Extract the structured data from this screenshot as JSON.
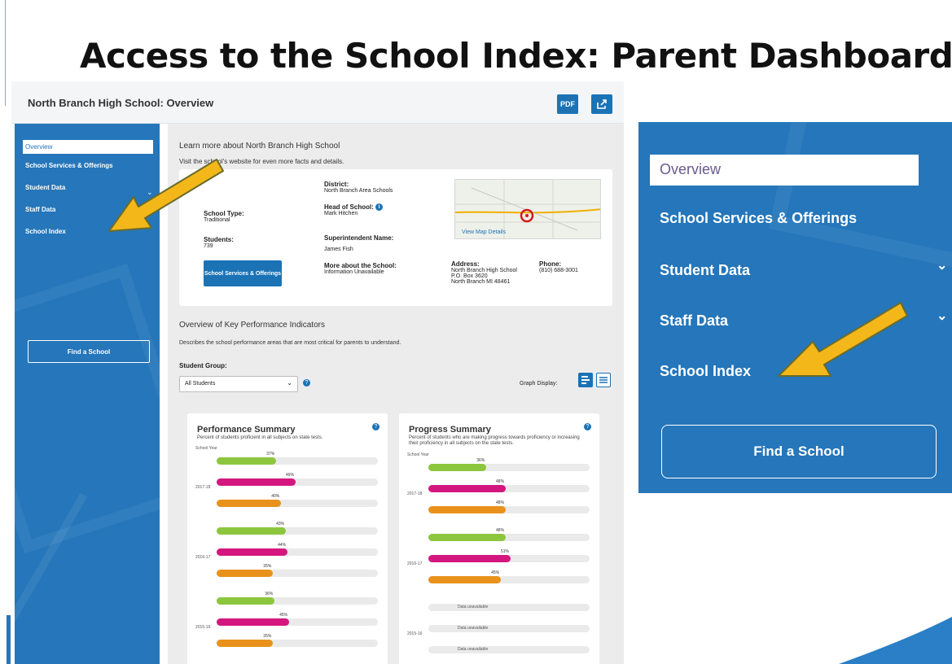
{
  "slide": {
    "title": "Access to the School Index: Parent Dashboard"
  },
  "dashboard": {
    "header_title": "North Branch High School: Overview",
    "pdf_label": "PDF",
    "share_icon": "share-icon",
    "sidebar": {
      "items": [
        {
          "label": "Overview",
          "active": true
        },
        {
          "label": "School Services & Offerings"
        },
        {
          "label": "Student Data"
        },
        {
          "label": "Staff Data"
        },
        {
          "label": "School Index"
        }
      ],
      "find_school": "Find a School"
    },
    "intro": {
      "learn_more": "Learn more about North Branch High School",
      "visit": "Visit the school's website for even more facts and details."
    },
    "info": {
      "district_label": "District:",
      "district_value": "North Branch Area Schools",
      "school_type_label": "School Type:",
      "school_type_value": "Traditional",
      "head_label": "Head of School:",
      "head_value": "Mark Hitchen",
      "students_label": "Students:",
      "students_value": "739",
      "superintendent_label": "Superintendent Name:",
      "superintendent_value": "James Fish",
      "more_label": "More about the School:",
      "more_value": "Information Unavailable",
      "address_label": "Address:",
      "address_line1": "North Branch High School",
      "address_line2": "P.O. Box 3620",
      "address_line3": "North Branch MI 48461",
      "phone_label": "Phone:",
      "phone_value": "(810) 688-3001",
      "services_button": "School Services & Offerings",
      "map_link": "View Map Details"
    },
    "kpi": {
      "title": "Overview of Key Performance Indicators",
      "description": "Describes the school performance areas that are most critical for parents to understand.",
      "student_group_label": "Student Group:",
      "student_group_value": "All Students",
      "display_label": "Graph Display:"
    },
    "colors": {
      "sidebar": "#2576ba",
      "green": "#8cc63e",
      "magenta": "#d4177f",
      "orange": "#e8921c"
    },
    "performance": {
      "title": "Performance Summary",
      "subtitle": "Percent of students proficient in all subjects on state tests.",
      "year_label": "School Year",
      "axis_ticks": [
        "0%",
        "20%",
        "40%",
        "60%",
        "80%",
        "100%"
      ],
      "groups": [
        {
          "year": "2017-18",
          "bars": [
            {
              "color": "green",
              "value": 37,
              "label": "37%"
            },
            {
              "color": "magenta",
              "value": 49,
              "label": "49%"
            },
            {
              "color": "orange",
              "value": 40,
              "label": "40%"
            }
          ]
        },
        {
          "year": "2016-17",
          "bars": [
            {
              "color": "green",
              "value": 43,
              "label": "43%"
            },
            {
              "color": "magenta",
              "value": 44,
              "label": "44%"
            },
            {
              "color": "orange",
              "value": 35,
              "label": "35%"
            }
          ]
        },
        {
          "year": "2015-16",
          "bars": [
            {
              "color": "green",
              "value": 36,
              "label": "36%"
            },
            {
              "color": "magenta",
              "value": 45,
              "label": "45%"
            },
            {
              "color": "orange",
              "value": 35,
              "label": "35%"
            }
          ]
        }
      ]
    },
    "progress": {
      "title": "Progress Summary",
      "subtitle": "Percent of students who are making progress towards proficiency or increasing their proficiency in all subjects on the state tests.",
      "year_label": "School Year",
      "not_available": "Data unavailable",
      "groups": [
        {
          "year": "2017-18",
          "bars": [
            {
              "color": "green",
              "value": 36,
              "label": "36%"
            },
            {
              "color": "magenta",
              "value": 48,
              "label": "48%"
            },
            {
              "color": "orange",
              "value": 48,
              "label": "48%"
            }
          ]
        },
        {
          "year": "2016-17",
          "bars": [
            {
              "color": "green",
              "value": 48,
              "label": "48%"
            },
            {
              "color": "magenta",
              "value": 51,
              "label": "51%"
            },
            {
              "color": "orange",
              "value": 45,
              "label": "45%"
            }
          ]
        },
        {
          "year": "2015-16",
          "bars": []
        }
      ]
    }
  },
  "zoom_nav": {
    "items": [
      {
        "label": "Overview",
        "active": true
      },
      {
        "label": "School Services & Offerings"
      },
      {
        "label": "Student Data",
        "has_chevron": true
      },
      {
        "label": "Staff Data",
        "has_chevron": true
      },
      {
        "label": "School Index"
      }
    ],
    "find_school": "Find a School",
    "chevron": "⌄"
  }
}
